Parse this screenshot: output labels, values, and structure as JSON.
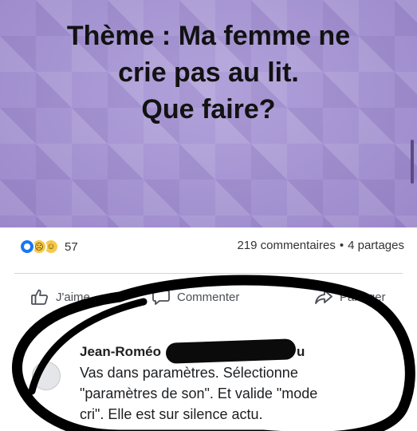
{
  "post": {
    "lines": [
      "Thème : Ma femme ne",
      "crie pas au lit.",
      "Que faire?"
    ],
    "background_color": "#a897d6"
  },
  "stats": {
    "reaction_icons": [
      "like-icon",
      "sad-face-icon",
      "wow-face-icon"
    ],
    "reaction_count": "57",
    "comments": "219 commentaires",
    "separator": "•",
    "shares": "4 partages"
  },
  "actions": {
    "like": "J'aime",
    "comment": "Commenter",
    "share": "Partager"
  },
  "comment": {
    "author_visible": "Jean-Roméo",
    "author_tail": "u",
    "lines": [
      "Vas dans paramètres. Sélectionne",
      "\"paramètres de son\". Et valide \"mode",
      "cri\". Elle est sur silence actu."
    ]
  },
  "colors": {
    "marker": "#000000",
    "accent": "#1877f2",
    "text": "#1c1e21"
  }
}
